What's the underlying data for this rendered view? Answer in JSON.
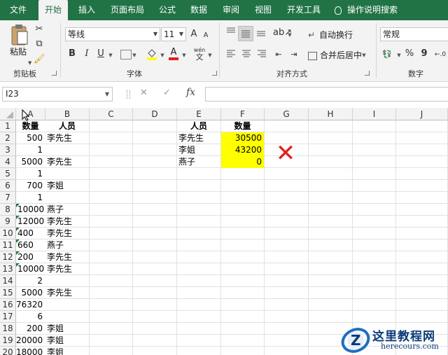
{
  "tabs": [
    "文件",
    "开始",
    "插入",
    "页面布局",
    "公式",
    "数据",
    "审阅",
    "视图",
    "开发工具"
  ],
  "active_tab": "开始",
  "tell_me": "操作说明搜索",
  "ribbon": {
    "clipboard": {
      "paste_label": "粘贴",
      "group_label": "剪贴板"
    },
    "font": {
      "font_name": "等线",
      "font_size": "11",
      "grow": "A",
      "shrink": "A",
      "bold": "B",
      "italic": "I",
      "underline": "U",
      "phonetic": "wén",
      "group_label": "字体"
    },
    "alignment": {
      "wrap_text": "自动换行",
      "merge_center": "合并后居中",
      "group_label": "对齐方式"
    },
    "number": {
      "format": "常规",
      "percent": "%",
      "comma": "9",
      "group_label": "数字"
    }
  },
  "formula_bar": {
    "name_box": "I23",
    "cancel": "✕",
    "enter": "✓",
    "fx": "fx",
    "formula": ""
  },
  "columns": [
    "A",
    "B",
    "C",
    "D",
    "E",
    "F",
    "G",
    "H",
    "I",
    "J"
  ],
  "rows": [
    "1",
    "2",
    "3",
    "4",
    "5",
    "6",
    "7",
    "8",
    "9",
    "10",
    "11",
    "12",
    "13",
    "14",
    "15",
    "16",
    "17",
    "18",
    "19",
    "20"
  ],
  "col_a_header": "数量",
  "col_b_header": "人员",
  "data_rows": [
    {
      "qty": "500",
      "person": "李先生",
      "text_num": false
    },
    {
      "qty": "1",
      "person": "",
      "text_num": false
    },
    {
      "qty": "5000",
      "person": "李先生",
      "text_num": false
    },
    {
      "qty": "1",
      "person": "",
      "text_num": false
    },
    {
      "qty": "700",
      "person": "李姐",
      "text_num": false
    },
    {
      "qty": "1",
      "person": "",
      "text_num": false
    },
    {
      "qty": "10000",
      "person": "燕子",
      "text_num": true
    },
    {
      "qty": "12000",
      "person": "李先生",
      "text_num": true
    },
    {
      "qty": "400",
      "person": "李先生",
      "text_num": true
    },
    {
      "qty": "660",
      "person": "燕子",
      "text_num": true
    },
    {
      "qty": "200",
      "person": "李先生",
      "text_num": true
    },
    {
      "qty": "10000",
      "person": "李先生",
      "text_num": true
    },
    {
      "qty": "2",
      "person": "",
      "text_num": false
    },
    {
      "qty": "5000",
      "person": "李先生",
      "text_num": false
    },
    {
      "qty": "76320",
      "person": "",
      "text_num": false
    },
    {
      "qty": "6",
      "person": "",
      "text_num": false
    },
    {
      "qty": "200",
      "person": "李姐",
      "text_num": false
    },
    {
      "qty": "20000",
      "person": "李姐",
      "text_num": false
    },
    {
      "qty": "18000",
      "person": "李姐",
      "text_num": false
    }
  ],
  "summary": {
    "header_person": "人员",
    "header_qty": "数量",
    "rows": [
      {
        "person": "李先生",
        "qty": "30500"
      },
      {
        "person": "李姐",
        "qty": "43200"
      },
      {
        "person": "燕子",
        "qty": "0"
      }
    ]
  },
  "mark": "✕",
  "watermark": {
    "site_cn": "这里教程网",
    "site_url": "herecours.com",
    "logo_letter": "Z"
  },
  "colors": {
    "excel_green": "#217346",
    "highlight": "#ffff00",
    "cross": "#e0201e",
    "text_number_flag": "#1e7c3c"
  }
}
